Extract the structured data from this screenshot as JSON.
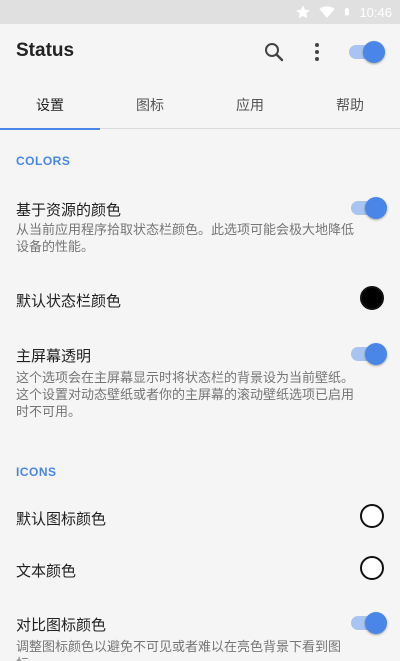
{
  "status_bar": {
    "time": "10:46",
    "icons": [
      "star-icon",
      "wifi-icon",
      "battery-icon"
    ]
  },
  "app_bar": {
    "title": "Status",
    "actions": [
      "search-icon",
      "more-vert-icon"
    ],
    "master_switch_on": true
  },
  "tabs": [
    {
      "label": "设置",
      "active": true
    },
    {
      "label": "图标",
      "active": false
    },
    {
      "label": "应用",
      "active": false
    },
    {
      "label": "帮助",
      "active": false
    }
  ],
  "sections": {
    "colors": {
      "header": "COLORS",
      "items": [
        {
          "title": "基于资源的颜色",
          "line1": "从当前应用程序拾取状态栏颜色。此选项可能会极大地降低",
          "line2": "设备的性能。",
          "switch_on": true
        },
        {
          "title": "默认状态栏颜色",
          "swatch": "#000000"
        },
        {
          "title": "主屏幕透明",
          "line1": "这个选项会在主屏幕显示时将状态栏的背景设为当前壁纸。",
          "line2": "这个设置对动态壁纸或者你的主屏幕的滚动壁纸选项已启用",
          "line3": "时不可用。",
          "switch_on": true
        }
      ]
    },
    "icons": {
      "header": "ICONS",
      "items": [
        {
          "title": "默认图标颜色",
          "swatch": "#ffffff"
        },
        {
          "title": "文本颜色",
          "swatch": "#ffffff"
        },
        {
          "title": "对比图标颜色",
          "line1": "调整图标颜色以避免不可见或者难以在亮色背景下看到图",
          "line2": "标。",
          "switch_on": true
        }
      ]
    }
  },
  "colors": {
    "accent": "#4a86e8",
    "switch_track": "#a9c4f1",
    "background": "#f5f5f5"
  }
}
